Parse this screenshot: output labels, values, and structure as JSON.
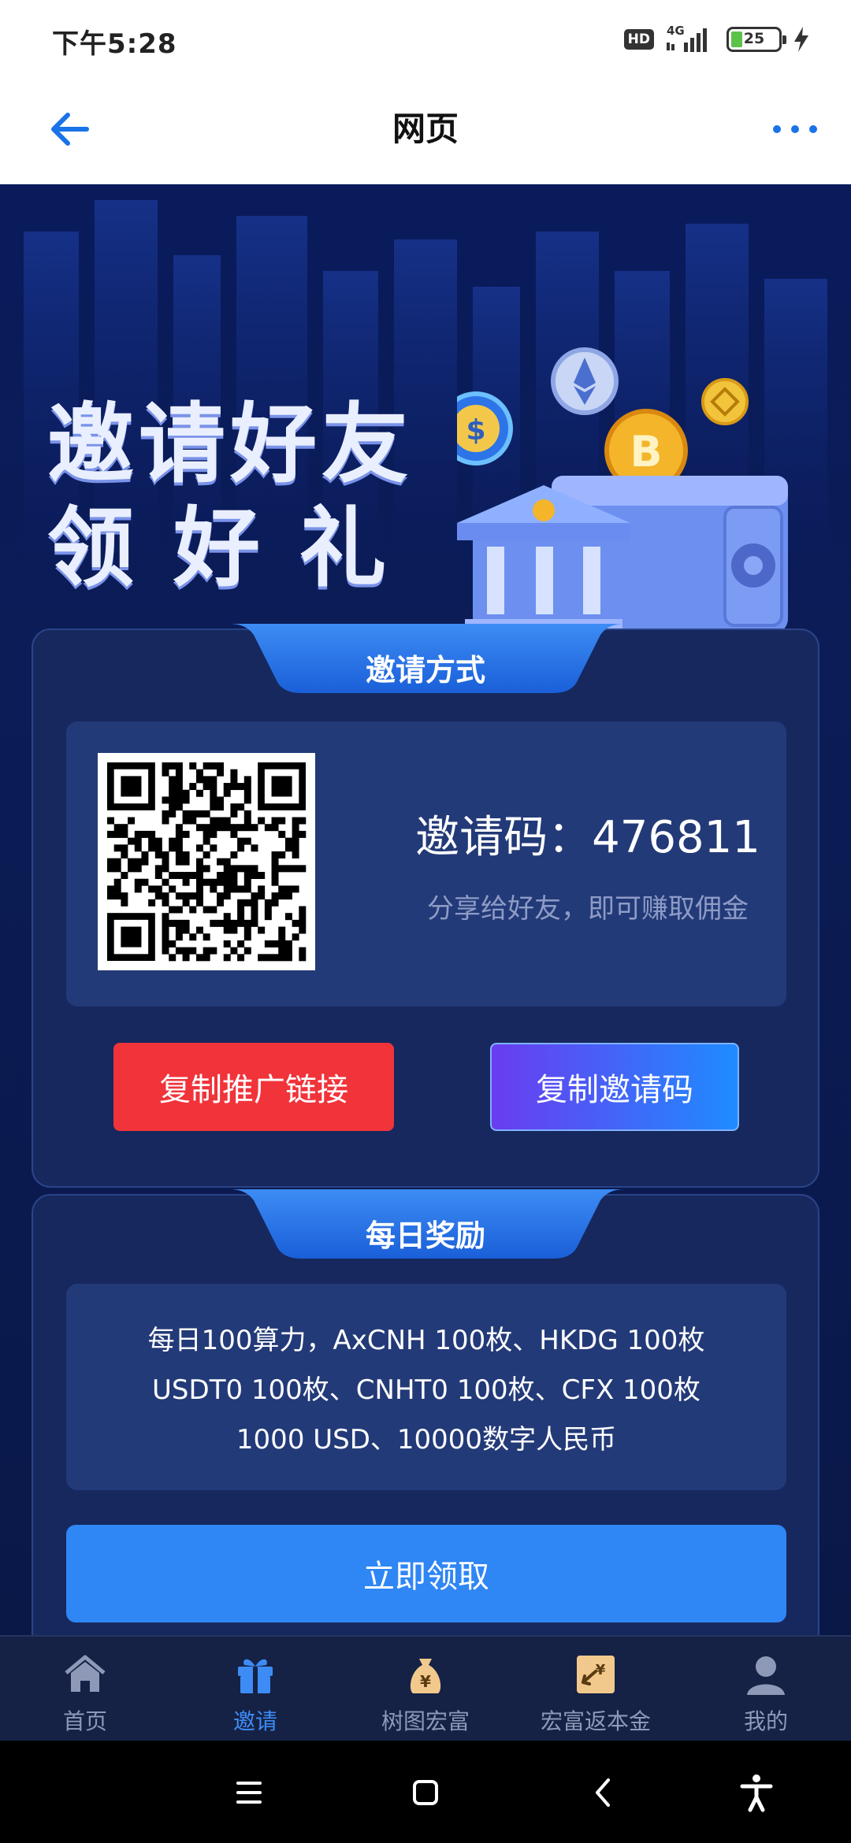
{
  "status_bar": {
    "time": "下午5:28",
    "hd": "HD",
    "network": "4G",
    "battery": "25"
  },
  "nav": {
    "title": "网页"
  },
  "banner": {
    "line1": "邀请好友",
    "line2": "领好礼"
  },
  "invite_card": {
    "tab_label": "邀请方式",
    "invite_code_label": "邀请码：476811",
    "hint": "分享给好友，即可赚取佣金",
    "copy_link_button": "复制推广链接",
    "copy_code_button": "复制邀请码"
  },
  "daily_card": {
    "tab_label": "每日奖励",
    "reward_lines": [
      "每日100算力，AxCNH 100枚、HKDG 100枚",
      "USDT0 100枚、CNHT0 100枚、CFX 100枚",
      "1000 USD、10000数字人民币"
    ],
    "claim_button": "立即领取"
  },
  "tab_bar": {
    "items": [
      {
        "label": "首页",
        "icon": "home-icon"
      },
      {
        "label": "邀请",
        "icon": "gift-icon"
      },
      {
        "label": "树图宏富",
        "icon": "money-bag-icon"
      },
      {
        "label": "宏富返本金",
        "icon": "exchange-icon"
      },
      {
        "label": "我的",
        "icon": "profile-icon"
      }
    ]
  },
  "colors": {
    "accent_blue": "#2f86f5",
    "copy_link_red": "#f1333a",
    "active_tab": "#3d8cf5",
    "card_bg": "#16285e"
  }
}
